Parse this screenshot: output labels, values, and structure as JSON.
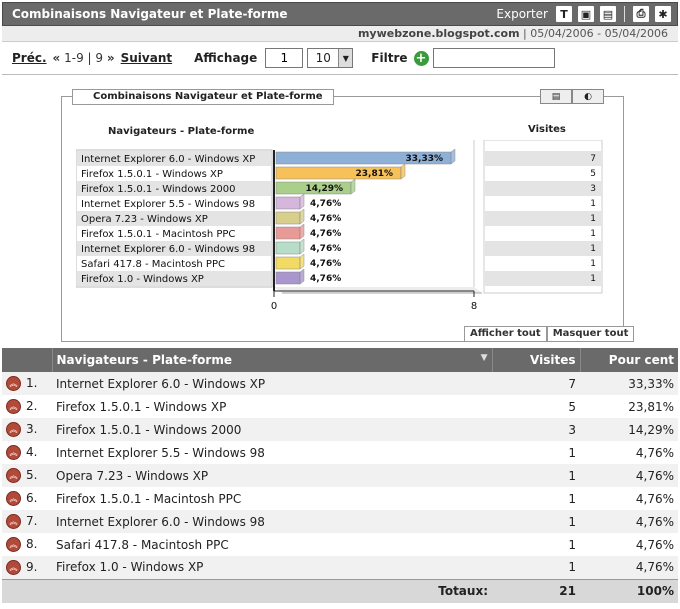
{
  "titlebar": {
    "title": "Combinaisons Navigateur et Plate-forme",
    "export_label": "Exporter"
  },
  "subhead": {
    "site": "mywebzone.blogspot.com",
    "date_range": "05/04/2006 - 05/04/2006"
  },
  "pager": {
    "prev": "Préc.",
    "range": "1-9 | 9",
    "next": "Suivant",
    "display_label": "Affichage",
    "display_start": "1",
    "display_count": "10",
    "filter_label": "Filtre",
    "filter_value": ""
  },
  "panel": {
    "title": "Combinaisons Navigateur et Plate-forme",
    "show_all": "Afficher tout",
    "hide_all": "Masquer tout"
  },
  "chart_data": {
    "type": "bar",
    "orientation": "horizontal",
    "left_header": "Navigateurs - Plate-forme",
    "right_header": "Visites",
    "categories": [
      "Internet Explorer 6.0 - Windows XP",
      "Firefox 1.5.0.1 - Windows XP",
      "Firefox 1.5.0.1 - Windows 2000",
      "Internet Explorer 5.5 - Windows 98",
      "Opera 7.23 - Windows XP",
      "Firefox 1.5.0.1 - Macintosh PPC",
      "Internet Explorer 6.0 - Windows 98",
      "Safari 417.8 - Macintosh PPC",
      "Firefox 1.0 - Windows XP"
    ],
    "values": [
      7,
      5,
      3,
      1,
      1,
      1,
      1,
      1,
      1
    ],
    "labels": [
      "33,33%",
      "23,81%",
      "14,29%",
      "4,76%",
      "4,76%",
      "4,76%",
      "4,76%",
      "4,76%",
      "4,76%"
    ],
    "colors": [
      "#8fb0d6",
      "#f7c15a",
      "#a9cf8a",
      "#d6b6dc",
      "#d8cf8c",
      "#e89a96",
      "#b7dcc8",
      "#f2da64",
      "#a896cc"
    ],
    "xlim": [
      0,
      8
    ],
    "xticks": [
      "0",
      "8"
    ]
  },
  "table": {
    "headers": {
      "name": "Navigateurs - Plate-forme",
      "visits": "Visites",
      "percent": "Pour cent"
    },
    "rows": [
      {
        "idx": "1.",
        "name": "Internet Explorer 6.0 - Windows XP",
        "visits": "7",
        "percent": "33,33%"
      },
      {
        "idx": "2.",
        "name": "Firefox 1.5.0.1 - Windows XP",
        "visits": "5",
        "percent": "23,81%"
      },
      {
        "idx": "3.",
        "name": "Firefox 1.5.0.1 - Windows 2000",
        "visits": "3",
        "percent": "14,29%"
      },
      {
        "idx": "4.",
        "name": "Internet Explorer 5.5 - Windows 98",
        "visits": "1",
        "percent": "4,76%"
      },
      {
        "idx": "5.",
        "name": "Opera 7.23 - Windows XP",
        "visits": "1",
        "percent": "4,76%"
      },
      {
        "idx": "6.",
        "name": "Firefox 1.5.0.1 - Macintosh PPC",
        "visits": "1",
        "percent": "4,76%"
      },
      {
        "idx": "7.",
        "name": "Internet Explorer 6.0 - Windows 98",
        "visits": "1",
        "percent": "4,76%"
      },
      {
        "idx": "8.",
        "name": "Safari 417.8 - Macintosh PPC",
        "visits": "1",
        "percent": "4,76%"
      },
      {
        "idx": "9.",
        "name": "Firefox 1.0 - Windows XP",
        "visits": "1",
        "percent": "4,76%"
      }
    ],
    "totals": {
      "label": "Totaux:",
      "visits": "21",
      "percent": "100%"
    }
  },
  "icons": {
    "text_export": "T",
    "export_glyph_2": "▣",
    "export_glyph_3": "▤",
    "print_glyph": "⎙",
    "settings_glyph": "✱",
    "filter_add": "+",
    "sort_arrow": "▼",
    "collapse_glyph": "︽",
    "select_arrow": "▼",
    "bar_view": "▤",
    "pie_view": "◐",
    "prev_arrows": "«",
    "next_arrows": "»"
  }
}
